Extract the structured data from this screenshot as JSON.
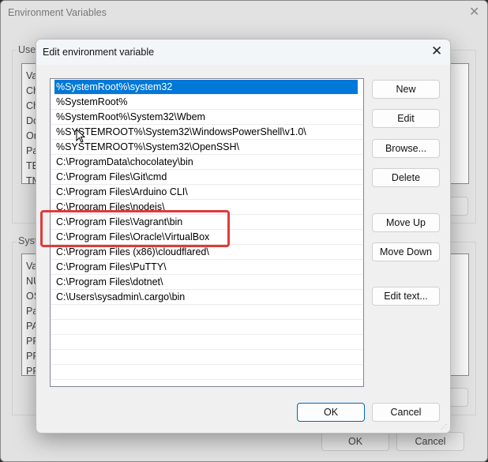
{
  "outer_window": {
    "title": "Environment Variables",
    "close_icon": "close-icon",
    "user_group_label": "User",
    "user_list_header": "Va",
    "user_list_items": [
      "Ch",
      "Ch",
      "Do",
      "On",
      "Pa",
      "TE",
      "TM"
    ],
    "system_group_label": "System",
    "system_list_header": "Va",
    "system_list_items": [
      "NU",
      "OS",
      "Pa",
      "PA",
      "PR",
      "PR",
      "PR"
    ],
    "ok_label": "OK",
    "cancel_label": "Cancel"
  },
  "dialog": {
    "title": "Edit environment variable",
    "close_icon": "close-icon",
    "paths": [
      "%SystemRoot%\\system32",
      "%SystemRoot%",
      "%SystemRoot%\\System32\\Wbem",
      "%SYSTEMROOT%\\System32\\WindowsPowerShell\\v1.0\\",
      "%SYSTEMROOT%\\System32\\OpenSSH\\",
      "C:\\ProgramData\\chocolatey\\bin",
      "C:\\Program Files\\Git\\cmd",
      "C:\\Program Files\\Arduino CLI\\",
      "C:\\Program Files\\nodejs\\",
      "C:\\Program Files\\Vagrant\\bin",
      "C:\\Program Files\\Oracle\\VirtualBox",
      "C:\\Program Files (x86)\\cloudflared\\",
      "C:\\Program Files\\PuTTY\\",
      "C:\\Program Files\\dotnet\\",
      "C:\\Users\\sysadmin\\.cargo\\bin"
    ],
    "selected_index": 0,
    "highlighted_items": [
      "C:\\Program Files\\Vagrant\\bin",
      "C:\\Program Files\\Oracle\\VirtualBox"
    ],
    "buttons": {
      "new": "New",
      "edit": "Edit",
      "browse": "Browse...",
      "delete": "Delete",
      "move_up": "Move Up",
      "move_down": "Move Down",
      "edit_text": "Edit text...",
      "ok": "OK",
      "cancel": "Cancel"
    },
    "colors": {
      "selection": "#0078d7",
      "highlight_box": "#e03a3a"
    }
  }
}
